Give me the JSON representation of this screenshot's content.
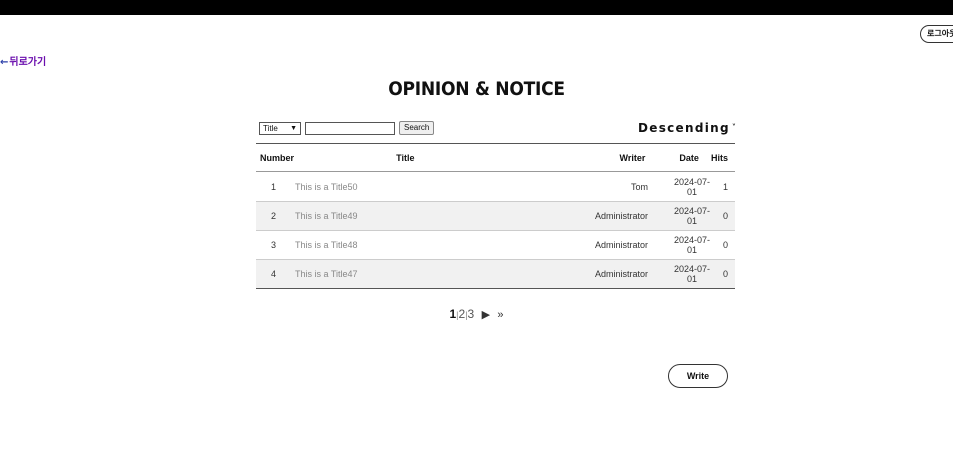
{
  "header": {
    "logout_label": "로그아웃",
    "back_arrow": "←",
    "back_label": "뒤로가기",
    "title": "OPINION & NOTICE"
  },
  "search": {
    "filter_value": "Title",
    "filter_icon": "chevron-down-icon",
    "input_value": "",
    "button_label": "Search"
  },
  "sort": {
    "label": "Descending",
    "caret": "˅"
  },
  "table": {
    "columns": [
      "Number",
      "Title",
      "Writer",
      "Date",
      "Hits"
    ],
    "rows": [
      {
        "number": "1",
        "title": "This is a Title50",
        "writer": "Tom",
        "date": "2024-07-01",
        "hits": "1"
      },
      {
        "number": "2",
        "title": "This is a Title49",
        "writer": "Administrator",
        "date": "2024-07-01",
        "hits": "0"
      },
      {
        "number": "3",
        "title": "This is a Title48",
        "writer": "Administrator",
        "date": "2024-07-01",
        "hits": "0"
      },
      {
        "number": "4",
        "title": "This is a Title47",
        "writer": "Administrator",
        "date": "2024-07-01",
        "hits": "0"
      }
    ]
  },
  "pagination": {
    "pages": [
      "1",
      "2",
      "3"
    ],
    "current": "1",
    "separator": "|",
    "next_icon": "▶",
    "last_icon": "»"
  },
  "write_label": "Write"
}
